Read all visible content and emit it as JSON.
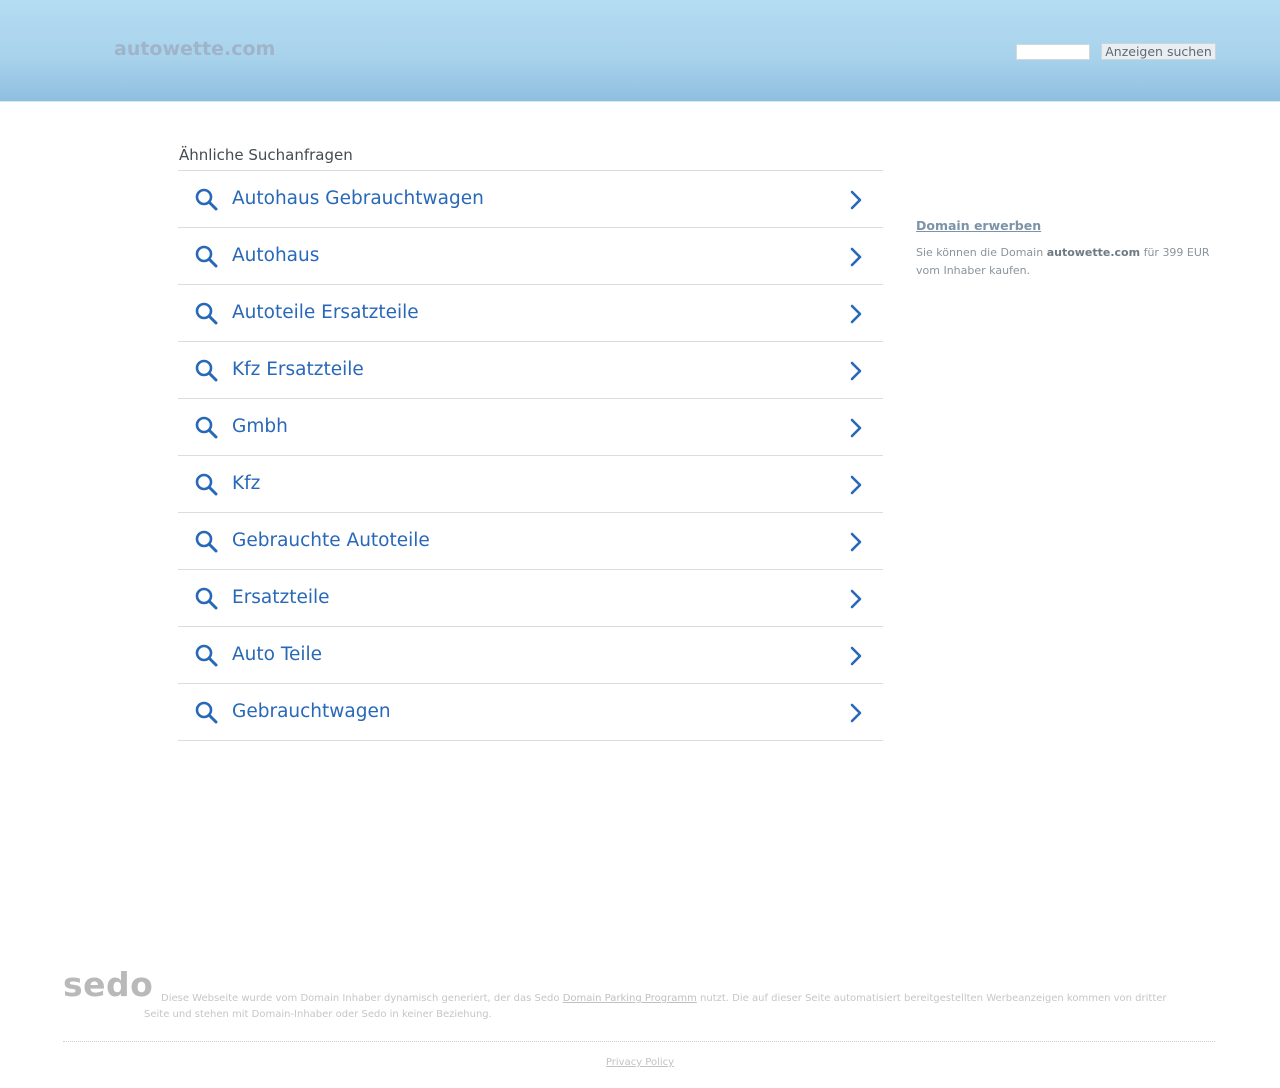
{
  "header": {
    "logo": "autowette.com",
    "search_input_value": "",
    "search_button_label": "Anzeigen suchen"
  },
  "related": {
    "title": "Ähnliche Suchanfragen",
    "items": [
      {
        "label": "Autohaus Gebrauchtwagen"
      },
      {
        "label": "Autohaus"
      },
      {
        "label": "Autoteile Ersatzteile"
      },
      {
        "label": "Kfz Ersatzteile"
      },
      {
        "label": "Gmbh"
      },
      {
        "label": "Kfz"
      },
      {
        "label": "Gebrauchte Autoteile"
      },
      {
        "label": "Ersatzteile"
      },
      {
        "label": "Auto Teile"
      },
      {
        "label": "Gebrauchtwagen"
      }
    ],
    "item_icon": "search-icon",
    "item_arrow_icon": "chevron-right-icon"
  },
  "domain_sale": {
    "title": "Domain erwerben",
    "text_before": "Sie können die Domain ",
    "domain": "autowette.com",
    "text_after": " für 399 EUR vom Inhaber kaufen."
  },
  "footer": {
    "logo": "sedo",
    "disclaimer_before": "Diese Webseite wurde vom Domain Inhaber dynamisch generiert, der das Sedo ",
    "disclaimer_link": "Domain Parking Programm",
    "disclaimer_after": " nutzt. Die auf dieser Seite automatisiert bereitgestellten Werbeanzeigen kommen von dritter Seite und stehen mit Domain-Inhaber oder Sedo in keiner Beziehung.",
    "privacy_label": "Privacy Policy"
  },
  "colors": {
    "link_blue": "#2868b8",
    "header_top": "#b4dcf2",
    "header_bottom": "#8fbfe0"
  }
}
